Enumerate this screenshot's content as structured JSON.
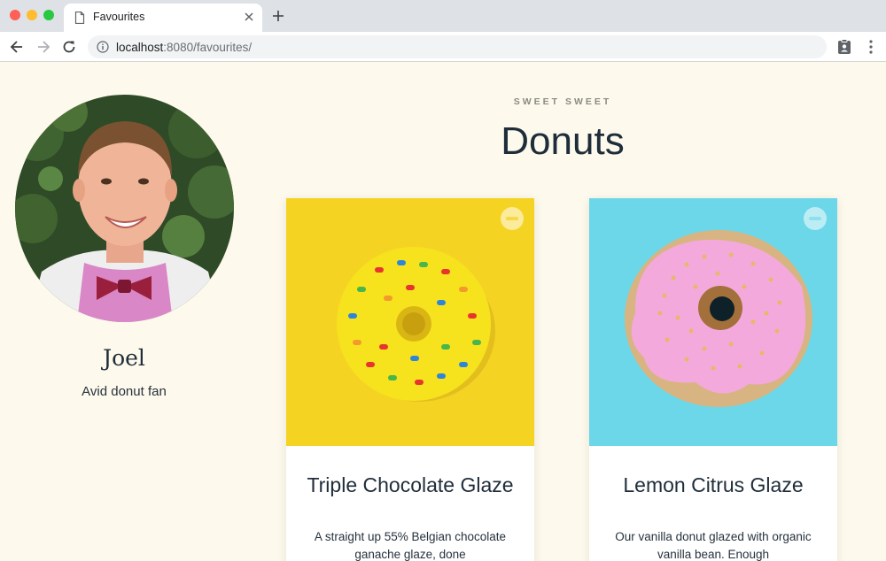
{
  "browser": {
    "tab_title": "Favourites",
    "url_host": "localhost",
    "url_path": ":8080/favourites/"
  },
  "profile": {
    "name": "Joel",
    "tagline": "Avid donut fan"
  },
  "header": {
    "eyebrow": "SWEET SWEET",
    "title": "Donuts"
  },
  "favourites": [
    {
      "title": "Triple Chocolate Glaze",
      "description": "A straight up 55% Belgian chocolate ganache glaze, done",
      "image_bg": "#f5d323"
    },
    {
      "title": "Lemon Citrus Glaze",
      "description": "Our vanilla donut glazed with organic vanilla bean. Enough",
      "image_bg": "#6bd7e8"
    }
  ],
  "colors": {
    "page_bg": "#fdf9ec",
    "text_dark": "#1f2d3a"
  }
}
